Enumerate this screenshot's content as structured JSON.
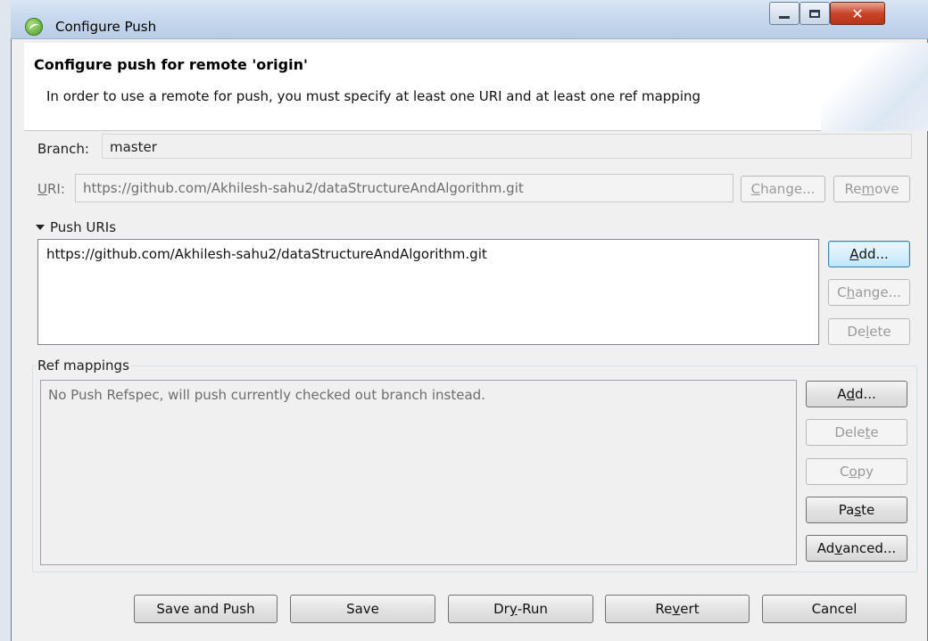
{
  "window": {
    "title": "Configure Push",
    "controls": {
      "minimize_icon": "minimize-icon",
      "maximize_icon": "maximize-icon",
      "close_icon": "close-icon"
    }
  },
  "header": {
    "title": "Configure push for remote 'origin'",
    "description": "In order to use a remote for push, you must specify at least one URI and at least one ref mapping"
  },
  "branch": {
    "label": "Branch:",
    "value": "master"
  },
  "uri": {
    "label_pre": "",
    "label_mn": "U",
    "label_post": "RI:",
    "value": "https://github.com/Akhilesh-sahu2/dataStructureAndAlgorithm.git",
    "change_button": {
      "pre": "",
      "mn": "C",
      "post": "hange..."
    },
    "remove_button": {
      "pre": "Re",
      "mn": "m",
      "post": "ove"
    }
  },
  "push_uris": {
    "section_label": "Push URIs",
    "items": [
      "https://github.com/Akhilesh-sahu2/dataStructureAndAlgorithm.git"
    ],
    "add_button": {
      "pre": "",
      "mn": "A",
      "post": "dd..."
    },
    "change_button": {
      "pre": "C",
      "mn": "h",
      "post": "ange..."
    },
    "delete_button": {
      "pre": "De",
      "mn": "l",
      "post": "ete"
    }
  },
  "ref_mappings": {
    "section_label": "Ref mappings",
    "placeholder": "No Push Refspec, will push currently checked out branch instead.",
    "add_button": {
      "pre": "A",
      "mn": "d",
      "post": "d..."
    },
    "delete_button": {
      "pre": "Dele",
      "mn": "t",
      "post": "e"
    },
    "copy_button": {
      "pre": "C",
      "mn": "o",
      "post": "py"
    },
    "paste_button": {
      "pre": "Pa",
      "mn": "s",
      "post": "te"
    },
    "advanced_button": {
      "pre": "Ad",
      "mn": "v",
      "post": "anced..."
    }
  },
  "footer": {
    "save_and_push": "Save and Push",
    "save": "Save",
    "dry_run": {
      "pre": "Dr",
      "mn": "y",
      "post": "-Run"
    },
    "revert": {
      "pre": "Re",
      "mn": "v",
      "post": "ert"
    },
    "cancel": "Cancel"
  }
}
